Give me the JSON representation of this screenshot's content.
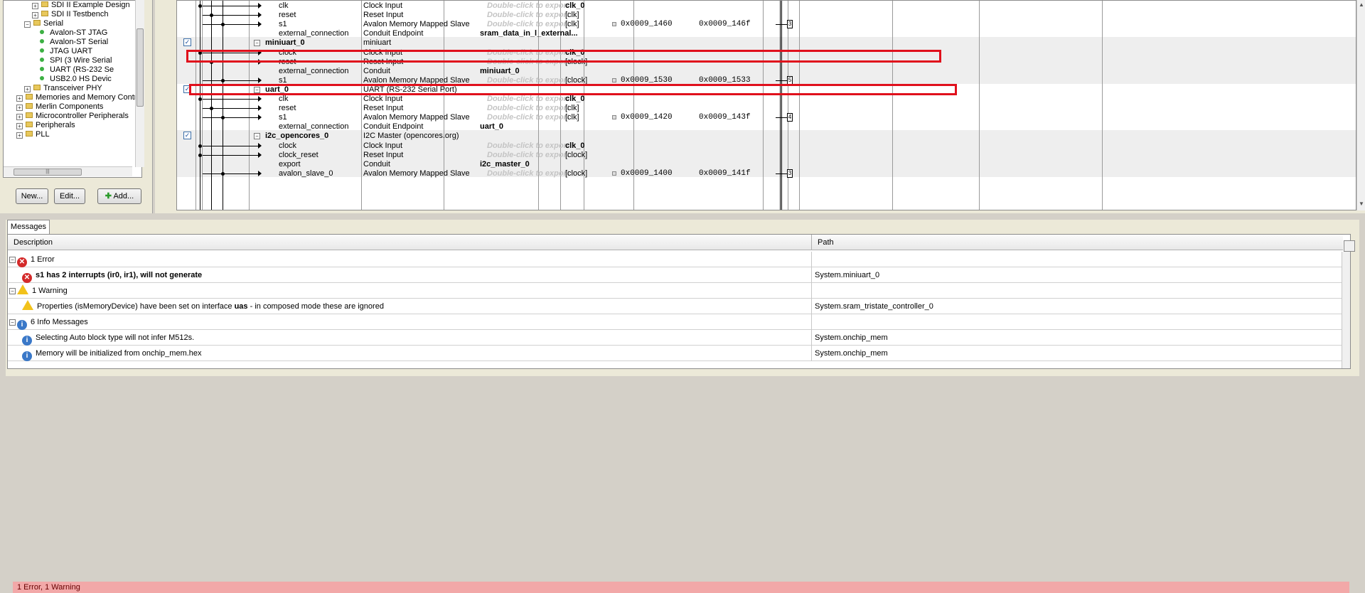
{
  "library": {
    "items": [
      {
        "label": "SDI II Example Design",
        "kind": "folder",
        "indent": 2
      },
      {
        "label": "SDI II Testbench",
        "kind": "folder",
        "indent": 2
      },
      {
        "label": "Serial",
        "kind": "folder-open",
        "indent": 1
      },
      {
        "label": "Avalon-ST JTAG",
        "kind": "leaf",
        "indent": 3
      },
      {
        "label": "Avalon-ST Serial",
        "kind": "leaf",
        "indent": 3
      },
      {
        "label": "JTAG UART",
        "kind": "leaf",
        "indent": 3
      },
      {
        "label": "SPI (3 Wire Serial",
        "kind": "leaf",
        "indent": 3
      },
      {
        "label": "UART (RS-232 Se",
        "kind": "leaf",
        "indent": 3
      },
      {
        "label": "USB2.0 HS Devic",
        "kind": "leaf",
        "indent": 3
      },
      {
        "label": "Transceiver PHY",
        "kind": "folder",
        "indent": 1
      },
      {
        "label": "Memories and Memory Contro",
        "kind": "folder",
        "indent": 0
      },
      {
        "label": "Merlin Components",
        "kind": "folder",
        "indent": 0
      },
      {
        "label": "Microcontroller Peripherals",
        "kind": "folder",
        "indent": 0
      },
      {
        "label": "Peripherals",
        "kind": "folder",
        "indent": 0
      },
      {
        "label": "PLL",
        "kind": "folder",
        "indent": 0
      }
    ],
    "hscroll_grip": "|||",
    "buttons": {
      "new": "New...",
      "edit": "Edit...",
      "add": "Add..."
    }
  },
  "system": {
    "export_hint": "Double-click to export",
    "rows": [
      {
        "name": "clk",
        "desc": "Clock Input",
        "clock": "clk_0",
        "clock_bold": true,
        "base": "",
        "end": "",
        "type": "port"
      },
      {
        "name": "reset",
        "desc": "Reset Input",
        "clock": "[clk]",
        "base": "",
        "end": "",
        "type": "port"
      },
      {
        "name": "s1",
        "desc": "Avalon Memory Mapped Slave",
        "clock": "[clk]",
        "base": "0x0009_1460",
        "end": "0x0009_146f",
        "type": "port"
      },
      {
        "name": "external_connection",
        "desc": "Conduit Endpoint",
        "export": "sram_data_in_l_external...",
        "clock": "",
        "base": "",
        "end": "",
        "type": "conduit"
      },
      {
        "name": "miniuart_0",
        "desc": "miniuart",
        "clock": "",
        "base": "",
        "end": "",
        "type": "module"
      },
      {
        "name": "clock",
        "desc": "Clock Input",
        "clock": "clk_0",
        "clock_bold": true,
        "base": "",
        "end": "",
        "type": "port"
      },
      {
        "name": "reset",
        "desc": "Reset Input",
        "clock": "[clock]",
        "base": "",
        "end": "",
        "type": "port"
      },
      {
        "name": "external_connection",
        "desc": "Conduit",
        "export": "miniuart_0",
        "clock": "",
        "base": "",
        "end": "",
        "type": "conduit"
      },
      {
        "name": "s1",
        "desc": "Avalon Memory Mapped Slave",
        "clock": "[clock]",
        "base": "0x0009_1530",
        "end": "0x0009_1533",
        "type": "port"
      },
      {
        "name": "uart_0",
        "desc": "UART (RS-232 Serial Port)",
        "clock": "",
        "base": "",
        "end": "",
        "type": "module"
      },
      {
        "name": "clk",
        "desc": "Clock Input",
        "clock": "clk_0",
        "clock_bold": true,
        "base": "",
        "end": "",
        "type": "port"
      },
      {
        "name": "reset",
        "desc": "Reset Input",
        "clock": "[clk]",
        "base": "",
        "end": "",
        "type": "port"
      },
      {
        "name": "s1",
        "desc": "Avalon Memory Mapped Slave",
        "clock": "[clk]",
        "base": "0x0009_1420",
        "end": "0x0009_143f",
        "type": "port"
      },
      {
        "name": "external_connection",
        "desc": "Conduit Endpoint",
        "export": "uart_0",
        "clock": "",
        "base": "",
        "end": "",
        "type": "conduit"
      },
      {
        "name": "i2c_opencores_0",
        "desc": "I2C Master (opencores.org)",
        "clock": "",
        "base": "",
        "end": "",
        "type": "module"
      },
      {
        "name": "clock",
        "desc": "Clock Input",
        "clock": "clk_0",
        "clock_bold": true,
        "base": "",
        "end": "",
        "type": "port"
      },
      {
        "name": "clock_reset",
        "desc": "Reset Input",
        "clock": "[clock]",
        "base": "",
        "end": "",
        "type": "port"
      },
      {
        "name": "export",
        "desc": "Conduit",
        "export": "i2c_master_0",
        "clock": "",
        "base": "",
        "end": "",
        "type": "conduit"
      },
      {
        "name": "avalon_slave_0",
        "desc": "Avalon Memory Mapped Slave",
        "clock": "[clock]",
        "base": "0x0009_1400",
        "end": "0x0009_141f",
        "type": "port"
      }
    ],
    "irq_markers": [
      "3",
      "5",
      "4",
      "3"
    ]
  },
  "messages": {
    "tab": "Messages",
    "col_description": "Description",
    "col_path": "Path",
    "rows": [
      {
        "kind": "group-error",
        "text": "1 Error",
        "path": ""
      },
      {
        "kind": "error",
        "text": "s1 has 2 interrupts (ir0, ir1), will not generate",
        "path": "System.miniuart_0"
      },
      {
        "kind": "group-warn",
        "text": "1 Warning",
        "path": ""
      },
      {
        "kind": "warn",
        "text_pre": "Properties (isMemoryDevice) have been set on interface ",
        "text_bold": "uas",
        "text_post": " - in composed mode these are ignored",
        "path": "System.sram_tristate_controller_0"
      },
      {
        "kind": "group-info",
        "text": "6 Info Messages",
        "path": ""
      },
      {
        "kind": "info",
        "text": "Selecting Auto block type will not infer M512s.",
        "path": "System.onchip_mem"
      },
      {
        "kind": "info",
        "text": "Memory will be initialized from onchip_mem.hex",
        "path": "System.onchip_mem"
      }
    ],
    "status": "1 Error, 1 Warning"
  },
  "colors": {
    "error": "#d42a2a",
    "warning": "#f2c21b",
    "info": "#3a78c8",
    "highlight": "#e0101c",
    "status_bg": "#f2a8a8"
  }
}
